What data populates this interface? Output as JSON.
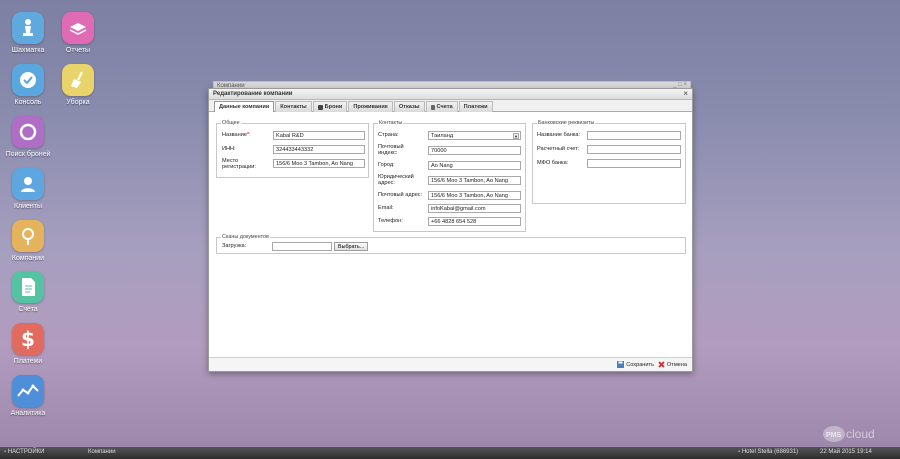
{
  "desktop": {
    "icons": [
      {
        "label": "Шахматка",
        "icon": "chess-icon",
        "color": "#5fa9dd"
      },
      {
        "label": "Отчеты",
        "icon": "reports-icon",
        "color": "#e06bb5"
      },
      {
        "label": "Консоль",
        "icon": "checkmark-icon",
        "color": "#5aa7e0"
      },
      {
        "label": "Уборка",
        "icon": "broom-icon",
        "color": "#e8d46a"
      },
      {
        "label": "Поиск броней",
        "icon": "search-ring-icon",
        "color": "#b06dc6"
      },
      {
        "label": "Клиенты",
        "icon": "person-icon",
        "color": "#5ea6df"
      },
      {
        "label": "Компании",
        "icon": "pin-icon",
        "color": "#e5b35c"
      },
      {
        "label": "Счета",
        "icon": "document-icon",
        "color": "#55c2a4"
      },
      {
        "label": "Платежи",
        "icon": "dollar-icon",
        "color": "#e06b5e"
      },
      {
        "label": "Аналитика",
        "icon": "chart-icon",
        "color": "#4f8fd9"
      }
    ]
  },
  "bg_window": {
    "title": "Компании"
  },
  "dialog": {
    "title": "Редактирование компании",
    "tabs": [
      {
        "label": "Данные компании",
        "active": true
      },
      {
        "label": "Контакты"
      },
      {
        "label": "Брони",
        "icon": "bookings-icon"
      },
      {
        "label": "Проживание"
      },
      {
        "label": "Отказы"
      },
      {
        "label": "Счета",
        "icon": "invoice-icon"
      },
      {
        "label": "Платежи"
      }
    ],
    "general": {
      "legend": "Общее",
      "name_label": "Название",
      "name_required": "*:",
      "name_value": "Kabal R&D",
      "inn_label": "ИНН:",
      "inn_value": "324433443332",
      "reg_label": "Место регистрации:",
      "reg_value": "156/6 Moo 3 Tambon, Ao Nang"
    },
    "contacts": {
      "legend": "Контакты",
      "country_label": "Страна:",
      "country_value": "Таиланд",
      "zip_label": "Почтовый индекс:",
      "zip_value": "70000",
      "city_label": "Город:",
      "city_value": "Ao Nang",
      "legal_label": "Юридический адрес:",
      "legal_value": "156/6 Moo 3 Tambon, Ao Nang",
      "postal_label": "Почтовый адрес:",
      "postal_value": "156/6 Moo 3 Tambon, Ao Nang",
      "email_label": "Email:",
      "email_value": "infoKabal@gmail.com",
      "phone_label": "Телефон:",
      "phone_value": "+66 4828 654 528"
    },
    "bank": {
      "legend": "Банковские реквизиты",
      "bank_name_label": "Название банка:",
      "bank_name_value": "",
      "account_label": "Расчетный счет:",
      "account_value": "",
      "mfo_label": "МФО банка:",
      "mfo_value": ""
    },
    "scans": {
      "legend": "Сканы документов",
      "upload_label": "Загрузка:",
      "upload_value": "",
      "browse_label": "Выбрать..."
    },
    "footer": {
      "save_label": "Сохранить",
      "cancel_label": "Отмена"
    }
  },
  "taskbar": {
    "settings_label": "НАСТРОЙКИ",
    "window_label": "Компании",
    "hotel_label": "Hotel Stella (686931)",
    "datetime": "22 Май 2015 19:14"
  },
  "logo": {
    "prefix": "PMS",
    "suffix": "cloud"
  }
}
